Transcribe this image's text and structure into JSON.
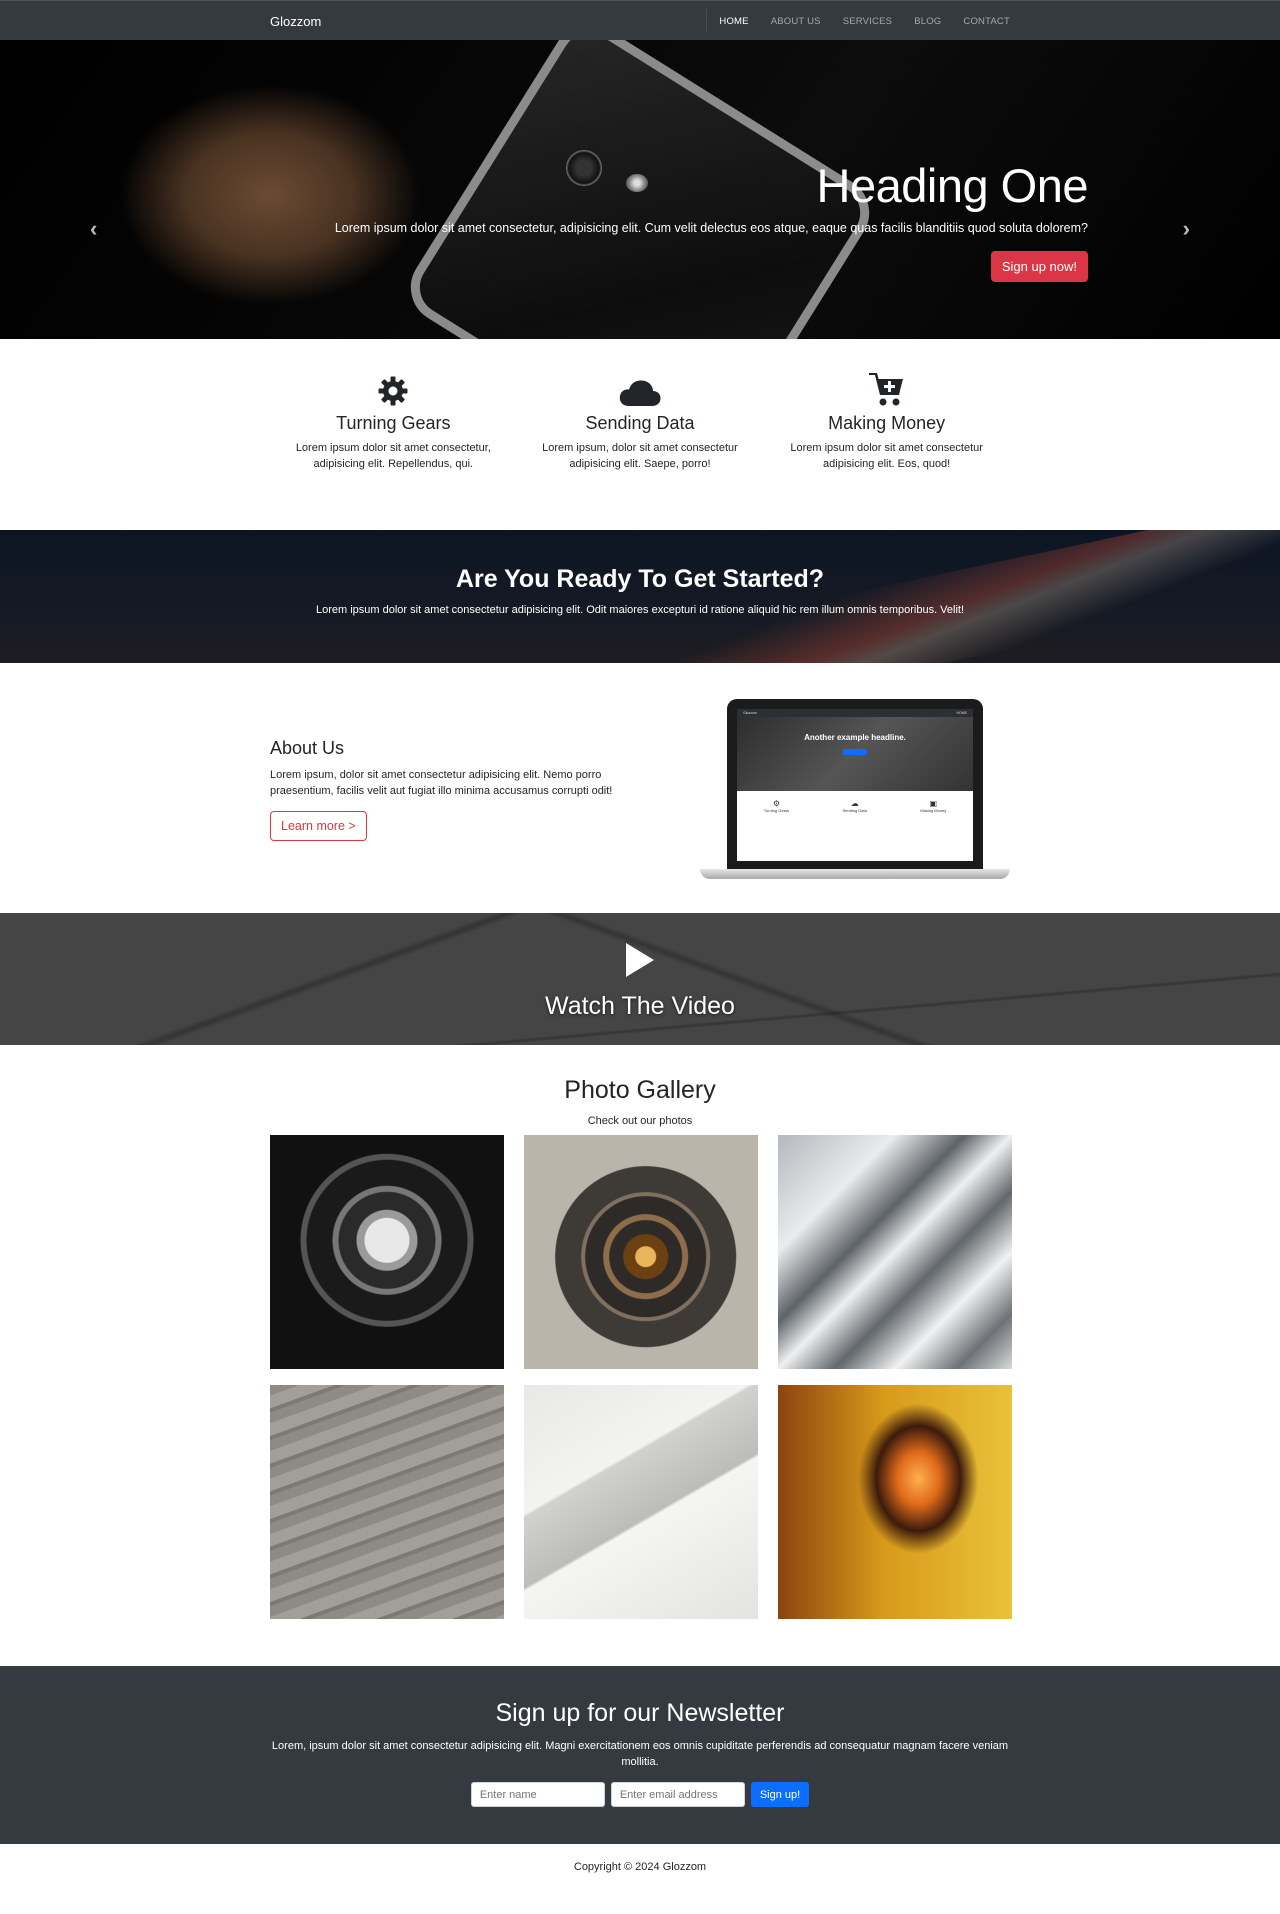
{
  "nav": {
    "brand": "Glozzom",
    "items": [
      "HOME",
      "ABOUT US",
      "SERVICES",
      "BLOG",
      "CONTACT"
    ]
  },
  "hero": {
    "heading": "Heading One",
    "text": "Lorem ipsum dolor sit amet consectetur, adipisicing elit. Cum velit delectus eos atque, eaque quas facilis blanditiis quod soluta dolorem?",
    "button": "Sign up now!",
    "slide_count": 3,
    "active_slide": 1
  },
  "features": [
    {
      "icon": "gear-icon",
      "title": "Turning Gears",
      "text": "Lorem ipsum dolor sit amet consectetur, adipisicing elit. Repellendus, qui."
    },
    {
      "icon": "cloud-icon",
      "title": "Sending Data",
      "text": "Lorem ipsum, dolor sit amet consectetur adipisicing elit. Saepe, porro!"
    },
    {
      "icon": "cart-plus-icon",
      "title": "Making Money",
      "text": "Lorem ipsum dolor sit amet consectetur adipisicing elit. Eos, quod!"
    }
  ],
  "ready": {
    "heading": "Are You Ready To Get Started?",
    "text": "Lorem ipsum dolor sit amet consectetur adipisicing elit. Odit maiores excepturi id ratione aliquid hic rem illum omnis temporibus. Velit!"
  },
  "about": {
    "heading": "About Us",
    "text": "Lorem ipsum, dolor sit amet consectetur adipisicing elit. Nemo porro praesentium, facilis velit aut fugiat illo minima accusamus corrupti odit!",
    "button": "Learn more >",
    "mockup": {
      "headline": "Another example headline.",
      "features": [
        "Turning Gears",
        "Sending Data",
        "Making Money"
      ]
    }
  },
  "video": {
    "heading": "Watch The Video"
  },
  "gallery": {
    "heading": "Photo Gallery",
    "subheading": "Check out our photos"
  },
  "newsletter": {
    "heading": "Sign up for our Newsletter",
    "text": "Lorem, ipsum dolor sit amet consectetur adipisicing elit. Magni exercitationem eos omnis cupiditate perferendis ad consequatur magnam facere veniam mollitia.",
    "name_placeholder": "Enter name",
    "email_placeholder": "Enter email address",
    "button": "Sign up!"
  },
  "footer": {
    "copyright": "Copyright © 2024 Glozzom"
  }
}
